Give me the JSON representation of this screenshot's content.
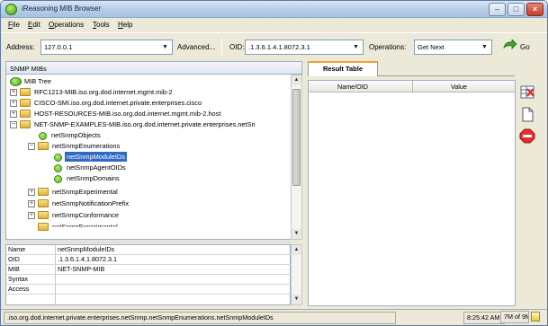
{
  "window": {
    "title": "iReasoning MIB Browser"
  },
  "menu": [
    {
      "key": "F",
      "rest": "ile"
    },
    {
      "key": "E",
      "rest": "dit"
    },
    {
      "key": "O",
      "rest": "perations"
    },
    {
      "key": "T",
      "rest": "ools"
    },
    {
      "key": "H",
      "rest": "elp"
    }
  ],
  "toolbar": {
    "address_label": "Address:",
    "address_value": "127.0.0.1",
    "advanced_label": "Advanced...",
    "oid_label": "OID:",
    "oid_value": ".1.3.6.1.4.1.8072.3.1",
    "operations_label": "Operations:",
    "operations_value": "Get Next",
    "go_label": "Go"
  },
  "left_panel": {
    "title": "SNMP MIBs"
  },
  "tree": {
    "root": "MIB Tree",
    "nodes": [
      {
        "label": "RFC1213-MIB.iso.org.dod.internet.mgmt.mib-2",
        "expander": "+"
      },
      {
        "label": "CISCO-SMI.iso.org.dod.internet.private.enterprises.cisco",
        "expander": "+"
      },
      {
        "label": "HOST-RESOURCES-MIB.iso.org.dod.internet.mgmt.mib-2.host",
        "expander": "+"
      },
      {
        "label": "NET-SNMP-EXAMPLES-MIB.iso.org.dod.internet.private.enterprises.netSn",
        "expander": "−"
      },
      {
        "label": "netSnmpObjects"
      },
      {
        "label": "netSnmpEnumerations",
        "expander": "−"
      },
      {
        "label": "netSnmpModuleIDs"
      },
      {
        "label": "netSnmpAgentOIDs"
      },
      {
        "label": "netSnmpDomains"
      },
      {
        "label": "netSnmpExperimental",
        "expander": "+"
      },
      {
        "label": "netSnmpNotificationPrefix",
        "expander": "+"
      },
      {
        "label": "netSnmpConformance",
        "expander": "+"
      },
      {
        "label": "netSnmpExperimental"
      }
    ]
  },
  "properties": [
    {
      "key": "Name",
      "value": "netSnmpModuleIDs"
    },
    {
      "key": "OID",
      "value": ".1.3.6.1.4.1.8072.3.1"
    },
    {
      "key": "MIB",
      "value": "NET-SNMP-MIB"
    },
    {
      "key": "Syntax",
      "value": ""
    },
    {
      "key": "Access",
      "value": ""
    }
  ],
  "result": {
    "tab_label": "Result Table",
    "columns": [
      "Name/OID",
      "Value"
    ]
  },
  "status": {
    "path": ".iso.org.dod.internet.private.enterprises.netSnmp.netSnmpEnumerations.netSnmpModuleIDs",
    "time": "8:25:42 AM",
    "memory": "7M of 9M"
  }
}
